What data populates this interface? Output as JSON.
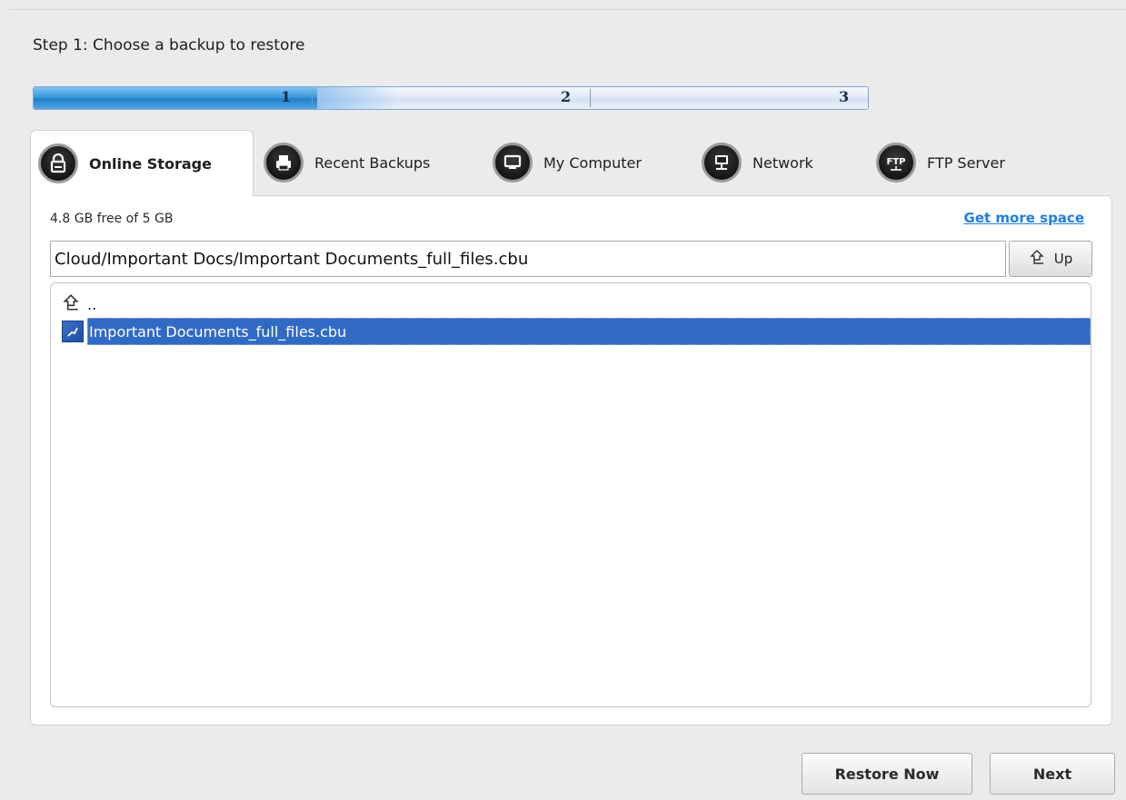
{
  "step_title": "Step 1: Choose a backup to restore",
  "progress": {
    "steps": [
      "1",
      "2",
      "3"
    ],
    "current_step": 1,
    "fill_fraction": 0.34
  },
  "tabs": [
    {
      "label": "Online Storage",
      "icon": "lock-icon",
      "active": true
    },
    {
      "label": "Recent Backups",
      "icon": "printer-icon",
      "active": false
    },
    {
      "label": "My Computer",
      "icon": "monitor-icon",
      "active": false
    },
    {
      "label": "Network",
      "icon": "network-computer-icon",
      "active": false
    },
    {
      "label": "FTP Server",
      "icon": "ftp-icon",
      "active": false
    }
  ],
  "storage": {
    "free_text": "4.8 GB free of 5 GB",
    "more_space_link": "Get more space"
  },
  "path": {
    "value": "Cloud/Important Docs/Important Documents_full_files.cbu",
    "up_label": "Up"
  },
  "file_list": {
    "parent_label": "..",
    "items": [
      {
        "name": "Important Documents_full_files.cbu",
        "selected": true
      }
    ]
  },
  "footer": {
    "restore_label": "Restore Now",
    "next_label": "Next"
  },
  "colors": {
    "progress_fill": "#1f7fc8",
    "selection": "#316ac5",
    "link": "#1f7fe0"
  }
}
